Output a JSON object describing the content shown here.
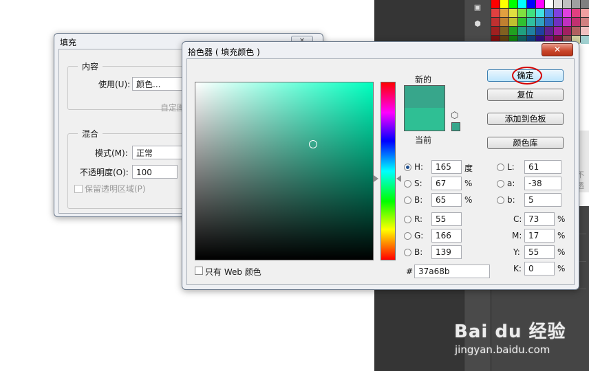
{
  "fill_dialog": {
    "title": "填充",
    "close_glyph": "✕",
    "contents_group": "内容",
    "use_label": "使用(U):",
    "use_value": "颜色...",
    "custom_pattern_label": "自定图",
    "blending_group": "混合",
    "mode_label": "模式(M):",
    "mode_value": "正常",
    "opacity_label": "不透明度(O):",
    "opacity_value": "100",
    "preserve_transparency_label": "保留透明区域(P)"
  },
  "color_picker": {
    "title": "拾色器 ( 填充颜色 )",
    "close_glyph": "✕",
    "new_label": "新的",
    "current_label": "当前",
    "new_color": "#37a68b",
    "current_color": "#2fbf94",
    "ok_button": "确定",
    "reset_button": "复位",
    "add_to_swatches_button": "添加到色板",
    "color_libraries_button": "颜色库",
    "only_web_colors_label": "只有 Web 颜色",
    "hsb": [
      {
        "label": "H:",
        "value": "165",
        "unit": "度",
        "selected": true
      },
      {
        "label": "S:",
        "value": "67",
        "unit": "%",
        "selected": false
      },
      {
        "label": "B:",
        "value": "65",
        "unit": "%",
        "selected": false
      }
    ],
    "rgb": [
      {
        "label": "R:",
        "value": "55"
      },
      {
        "label": "G:",
        "value": "166"
      },
      {
        "label": "B:",
        "value": "139"
      }
    ],
    "lab": [
      {
        "label": "L:",
        "value": "61"
      },
      {
        "label": "a:",
        "value": "-38"
      },
      {
        "label": "b:",
        "value": "5"
      }
    ],
    "cmyk": [
      {
        "label": "C:",
        "value": "73",
        "unit": "%"
      },
      {
        "label": "M:",
        "value": "17",
        "unit": "%"
      },
      {
        "label": "Y:",
        "value": "55",
        "unit": "%"
      },
      {
        "label": "K:",
        "value": "0",
        "unit": "%"
      }
    ],
    "hex_label": "#",
    "hex_value": "37a68b"
  },
  "background": {
    "side_panel_text": "不透"
  },
  "watermark": {
    "logo": "Bai du 经验",
    "url": "jingyan.baidu.com"
  }
}
